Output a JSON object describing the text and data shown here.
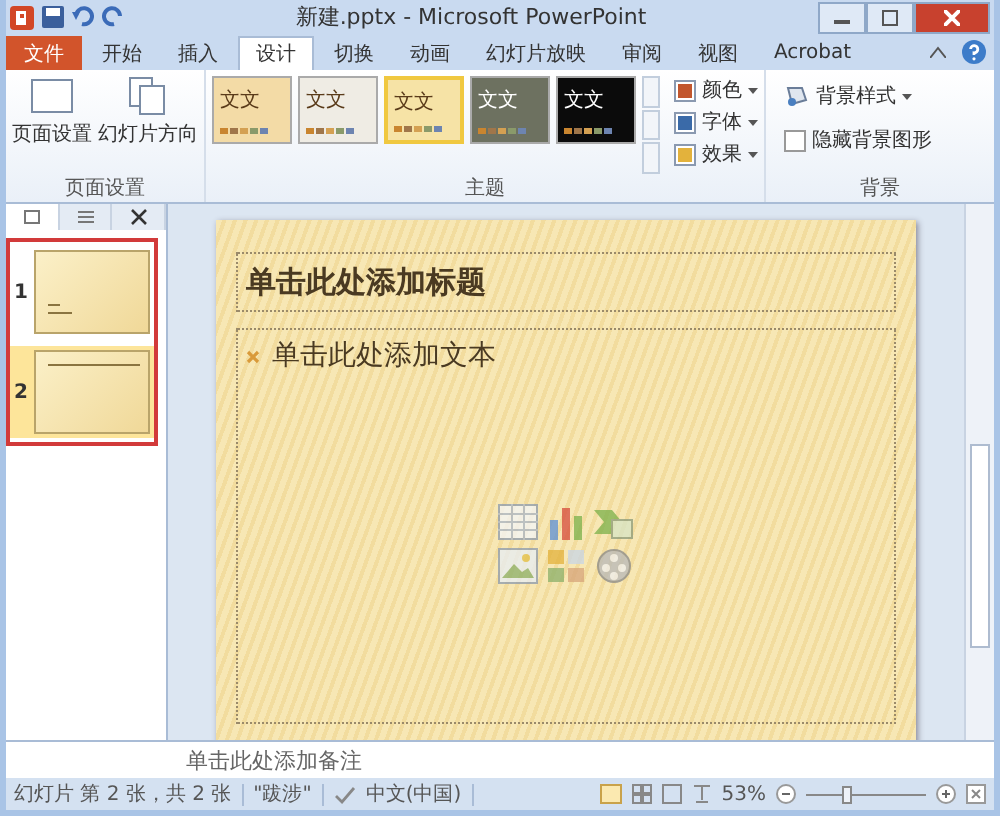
{
  "window": {
    "title": "新建.pptx - Microsoft PowerPoint"
  },
  "tabs": [
    {
      "label": "文件",
      "kind": "file",
      "selected": false
    },
    {
      "label": "开始",
      "kind": "tab",
      "selected": false
    },
    {
      "label": "插入",
      "kind": "tab",
      "selected": false
    },
    {
      "label": "设计",
      "kind": "tab",
      "selected": true
    },
    {
      "label": "切换",
      "kind": "tab",
      "selected": false
    },
    {
      "label": "动画",
      "kind": "tab",
      "selected": false
    },
    {
      "label": "幻灯片放映",
      "kind": "tab",
      "selected": false
    },
    {
      "label": "审阅",
      "kind": "tab",
      "selected": false
    },
    {
      "label": "视图",
      "kind": "tab",
      "selected": false
    },
    {
      "label": "Acrobat",
      "kind": "tab",
      "selected": false
    }
  ],
  "page_setup": {
    "buttons": [
      {
        "label": "页面设置"
      },
      {
        "label": "幻灯片方向"
      }
    ],
    "group_label": "页面设置"
  },
  "themes": {
    "items": [
      {
        "sample": "文文",
        "color": "#f3dba6",
        "selected": false
      },
      {
        "sample": "文文",
        "color": "#efece4",
        "selected": false
      },
      {
        "sample": "文文",
        "color": "#f6e3a6",
        "selected": true
      },
      {
        "sample": "文文",
        "color": "#6d7160",
        "selected": false
      },
      {
        "sample": "文文",
        "color": "#0b0b0b",
        "selected": false
      }
    ],
    "options": [
      {
        "label": "颜色"
      },
      {
        "label": "字体"
      },
      {
        "label": "效果"
      }
    ],
    "group_label": "主题"
  },
  "background": {
    "style_label": "背景样式",
    "hide_graphics": {
      "label": "隐藏背景图形",
      "checked": false
    },
    "group_label": "背景"
  },
  "slides": [
    {
      "number": "1",
      "selected": false
    },
    {
      "number": "2",
      "selected": true
    }
  ],
  "slide": {
    "title_placeholder": "单击此处添加标题",
    "body_placeholder": "单击此处添加文本"
  },
  "notes": {
    "placeholder": "单击此处添加备注"
  },
  "status_bar": {
    "slide_info": "幻灯片 第 2 张，共 2 张",
    "theme": "\"跋涉\"",
    "language": "中文(中国)",
    "zoom": "53%",
    "level": 0.35
  }
}
